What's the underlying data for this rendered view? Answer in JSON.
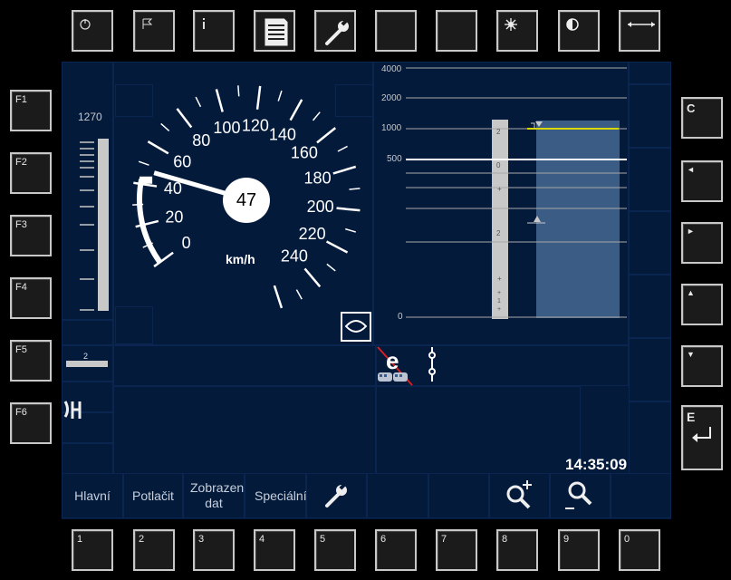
{
  "top_keys": [
    {
      "icon": "power-icon"
    },
    {
      "icon": "flag-icon"
    },
    {
      "icon": "info-icon"
    },
    {
      "icon": "document-icon"
    },
    {
      "icon": "wrench-icon"
    },
    {
      "icon": "blank"
    },
    {
      "icon": "blank"
    },
    {
      "icon": "brightness-icon"
    },
    {
      "icon": "contrast-icon"
    },
    {
      "icon": "width-arrows-icon"
    }
  ],
  "left_keys": [
    "F1",
    "F2",
    "F3",
    "F4",
    "F5",
    "F6"
  ],
  "right_keys": [
    {
      "label": "C",
      "icon": ""
    },
    {
      "label": "◄",
      "icon": "arrow-left-icon"
    },
    {
      "label": "►",
      "icon": "arrow-right-icon"
    },
    {
      "label": "▲",
      "icon": "arrow-up-icon"
    },
    {
      "label": "▼",
      "icon": "arrow-down-icon"
    },
    {
      "label": "E",
      "icon": "enter-icon"
    }
  ],
  "bottom_keys": [
    "1",
    "2",
    "3",
    "4",
    "5",
    "6",
    "7",
    "8",
    "9",
    "0"
  ],
  "speedometer": {
    "speed": "47",
    "unit": "km/h",
    "ticks": [
      "0",
      "20",
      "40",
      "60",
      "80",
      "100",
      "120",
      "140",
      "160",
      "180",
      "200",
      "220",
      "240"
    ]
  },
  "left_gauge": {
    "value_label": "1270"
  },
  "distance_scale": {
    "labels": [
      "4000",
      "2000",
      "1000",
      "500",
      "0"
    ]
  },
  "track_labels": [
    "2",
    "0",
    "+",
    "2",
    "+",
    "+",
    "1",
    "+"
  ],
  "level_indicator": "2",
  "clock": "14:35:09",
  "bottom_menu": [
    "Hlavní",
    "Potlačit",
    "Zobrazení dat",
    "Speciální"
  ],
  "colors": {
    "background": "#031a3b",
    "yellow_line": "#d8d800",
    "pdc_blue": "#3a5c85"
  }
}
